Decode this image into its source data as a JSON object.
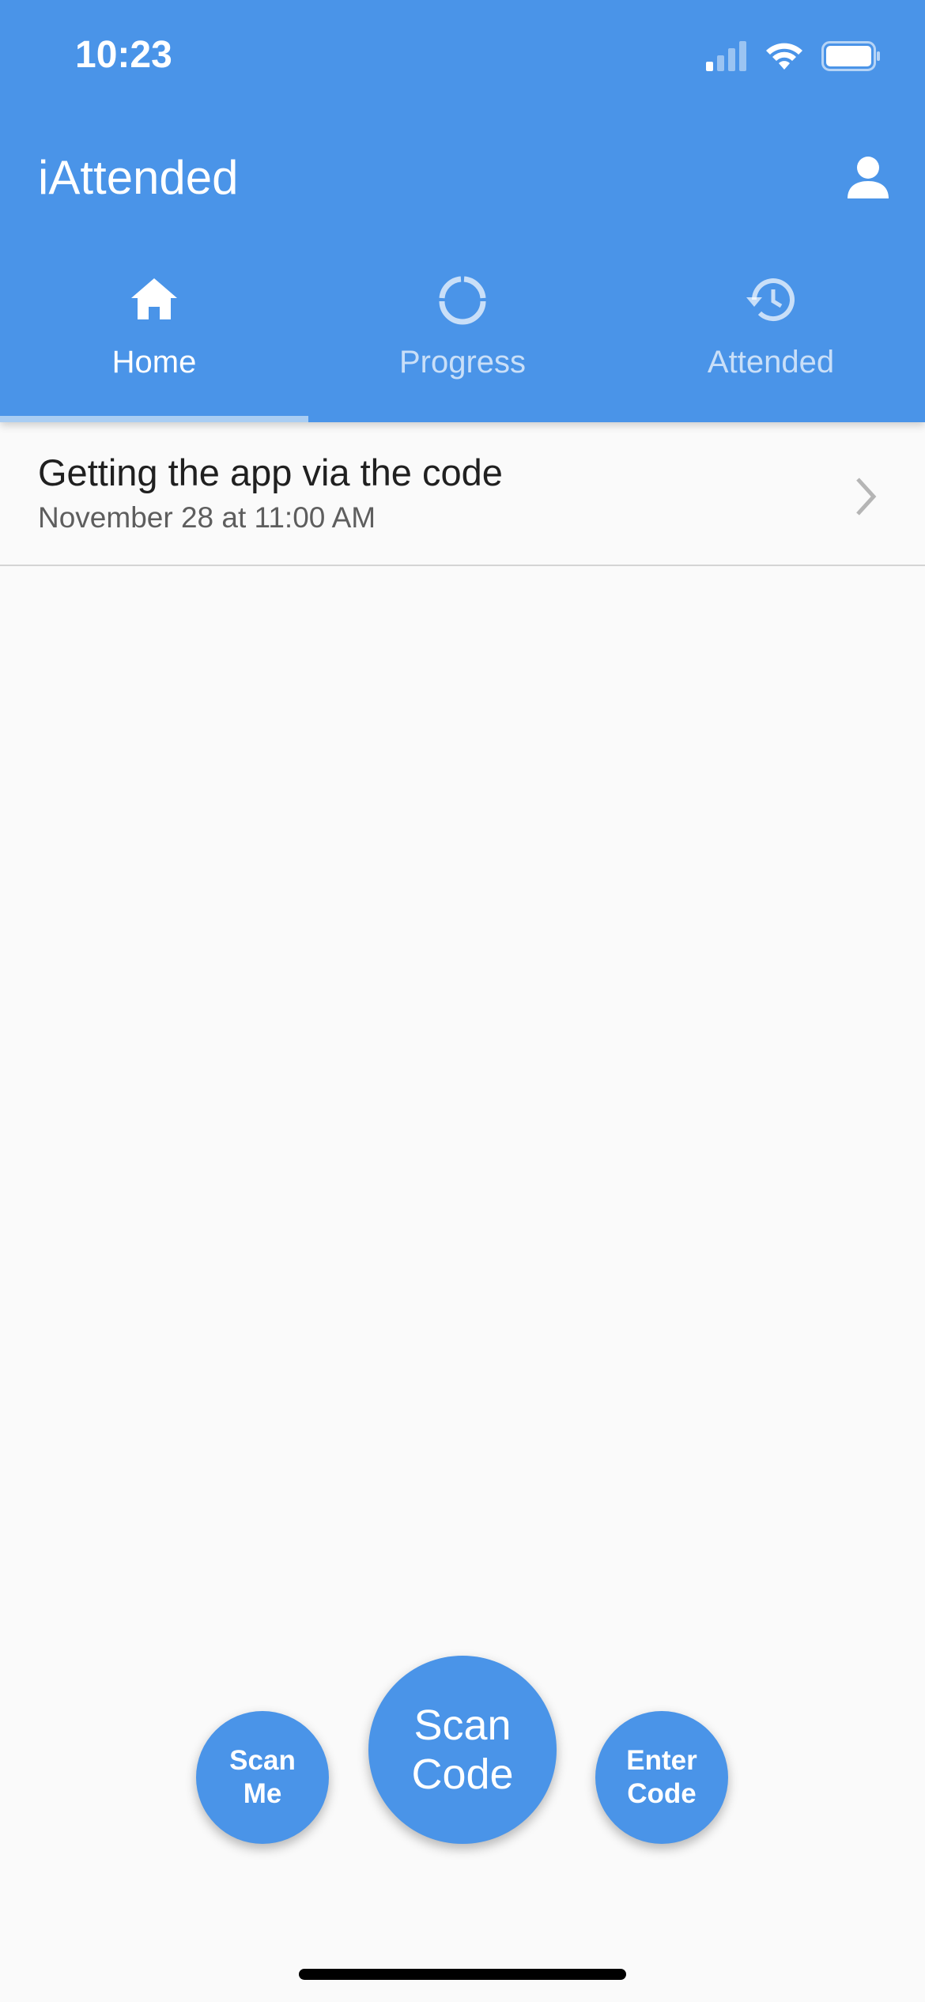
{
  "status_bar": {
    "time": "10:23",
    "icons": [
      "cellular-signal-icon",
      "wifi-icon",
      "battery-icon"
    ]
  },
  "app_bar": {
    "title": "iAttended",
    "profile_icon": "person-icon"
  },
  "tabs": [
    {
      "label": "Home",
      "icon": "home-icon",
      "active": true
    },
    {
      "label": "Progress",
      "icon": "progress-ring-icon",
      "active": false
    },
    {
      "label": "Attended",
      "icon": "history-icon",
      "active": false
    }
  ],
  "events": [
    {
      "title": "Getting the app via the code",
      "subtitle": "November 28 at 11:00 AM"
    }
  ],
  "actions": {
    "scan_me": "Scan\nMe",
    "scan_code": "Scan\nCode",
    "enter_code": "Enter\nCode"
  },
  "colors": {
    "primary": "#4a94e8",
    "background": "#fafafa",
    "tab_indicator": "#a9cdf3"
  }
}
